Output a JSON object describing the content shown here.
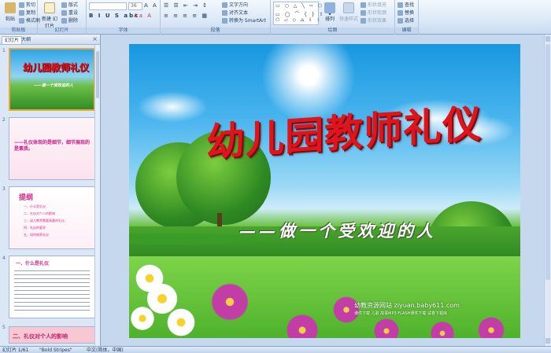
{
  "ribbon": {
    "clipboard": {
      "label": "剪贴板",
      "paste": "粘贴",
      "cut": "剪切",
      "copy": "复制",
      "format_painter": "格式刷"
    },
    "slides": {
      "label": "幻灯片",
      "new_slide": "新建\n幻灯片",
      "layout": "版式",
      "reset": "重设",
      "delete": "删除"
    },
    "font": {
      "label": "字体",
      "font_name": "",
      "font_size": "36"
    },
    "paragraph": {
      "label": "段落",
      "text_direction": "文字方向",
      "align_text": "对齐文本",
      "smartart": "转换为 SmartArt"
    },
    "drawing": {
      "label": "绘图",
      "arrange": "排列",
      "quick_styles": "快速样式",
      "shape_fill": "形状填充",
      "shape_outline": "形状轮廓",
      "shape_effects": "形状效果"
    },
    "editing": {
      "label": "编辑",
      "find": "查找",
      "replace": "替换",
      "select": "选择"
    }
  },
  "left_panel": {
    "tabs": [
      "幻灯片",
      "大纲"
    ],
    "close": "×",
    "thumbnails": [
      {
        "num": "1",
        "title": "幼儿园教师礼仪",
        "sub": "——做一个受欢迎的人"
      },
      {
        "num": "2",
        "text": "——礼仪体现的是细节，细节展现的是素质。"
      },
      {
        "num": "3",
        "heading": "提纲",
        "items": [
          "一、什么是礼仪",
          "二、礼仪对个人的影响",
          "三、幼儿教师需要具备的礼仪",
          "四、礼仪的要求",
          "五、如何修养礼仪"
        ]
      },
      {
        "num": "4",
        "heading": "一、什么是礼仪"
      },
      {
        "num": "5",
        "heading": "二、礼仪对个人的影响"
      }
    ]
  },
  "slide": {
    "title": "幼儿园教师礼仪",
    "subtitle": "——做一个受欢迎的人",
    "watermark": "幼教资源网站  ziyuan.baby611.com",
    "watermark_sub": "课件下载  儿歌  故事MP3  FLASH课件下载  试卷下载库"
  },
  "status_bar": {
    "slide_info": "幻灯片 1/61",
    "theme": "\"Bold Stripes\"",
    "language": "中文(简体，中国)"
  },
  "colors": {
    "title_red": "#e0141c",
    "selected_border": "#f2a33a",
    "ribbon_bg": "#dbe8f7"
  }
}
